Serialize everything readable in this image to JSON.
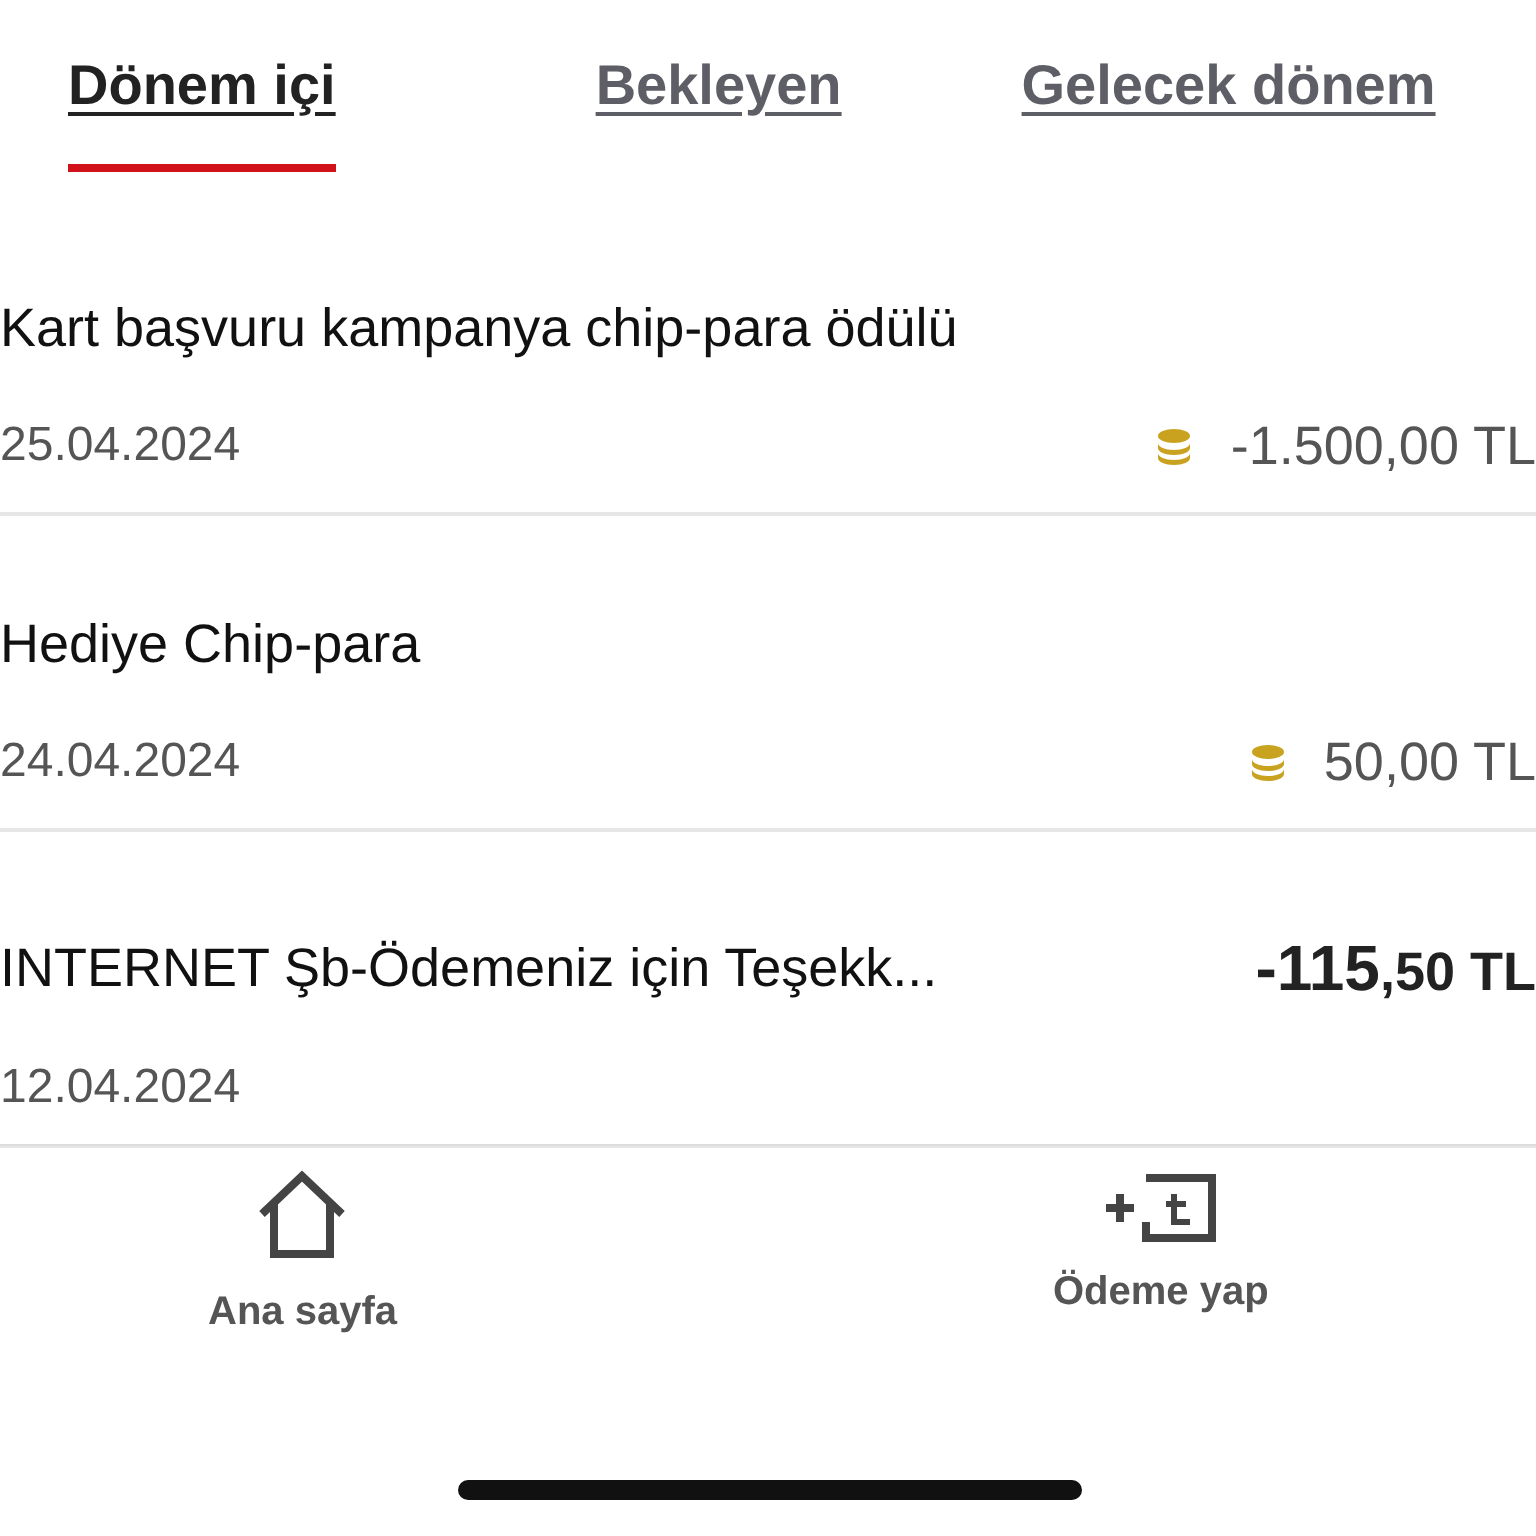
{
  "tabs": [
    {
      "label": "Dönem içi",
      "selected": true
    },
    {
      "label": "Bekleyen",
      "selected": false
    },
    {
      "label": "Gelecek dönem",
      "selected": false
    }
  ],
  "transactions": [
    {
      "title": "Kart başvuru kampanya chip-para ödülü",
      "date": "25.04.2024",
      "kind": "chip",
      "amount": "-1.500,00 TL"
    },
    {
      "title": "Hediye Chip-para",
      "date": "24.04.2024",
      "kind": "chip",
      "amount": "50,00 TL"
    },
    {
      "title": "INTERNET Şb-Ödemeniz için Teşekk...",
      "date": "12.04.2024",
      "kind": "money",
      "amount_main": "-115",
      "amount_rest": ",50 TL"
    }
  ],
  "nav": [
    {
      "kind": "home",
      "label": "Ana sayfa"
    },
    {
      "kind": "pay",
      "label": "Ödeme yap"
    }
  ]
}
